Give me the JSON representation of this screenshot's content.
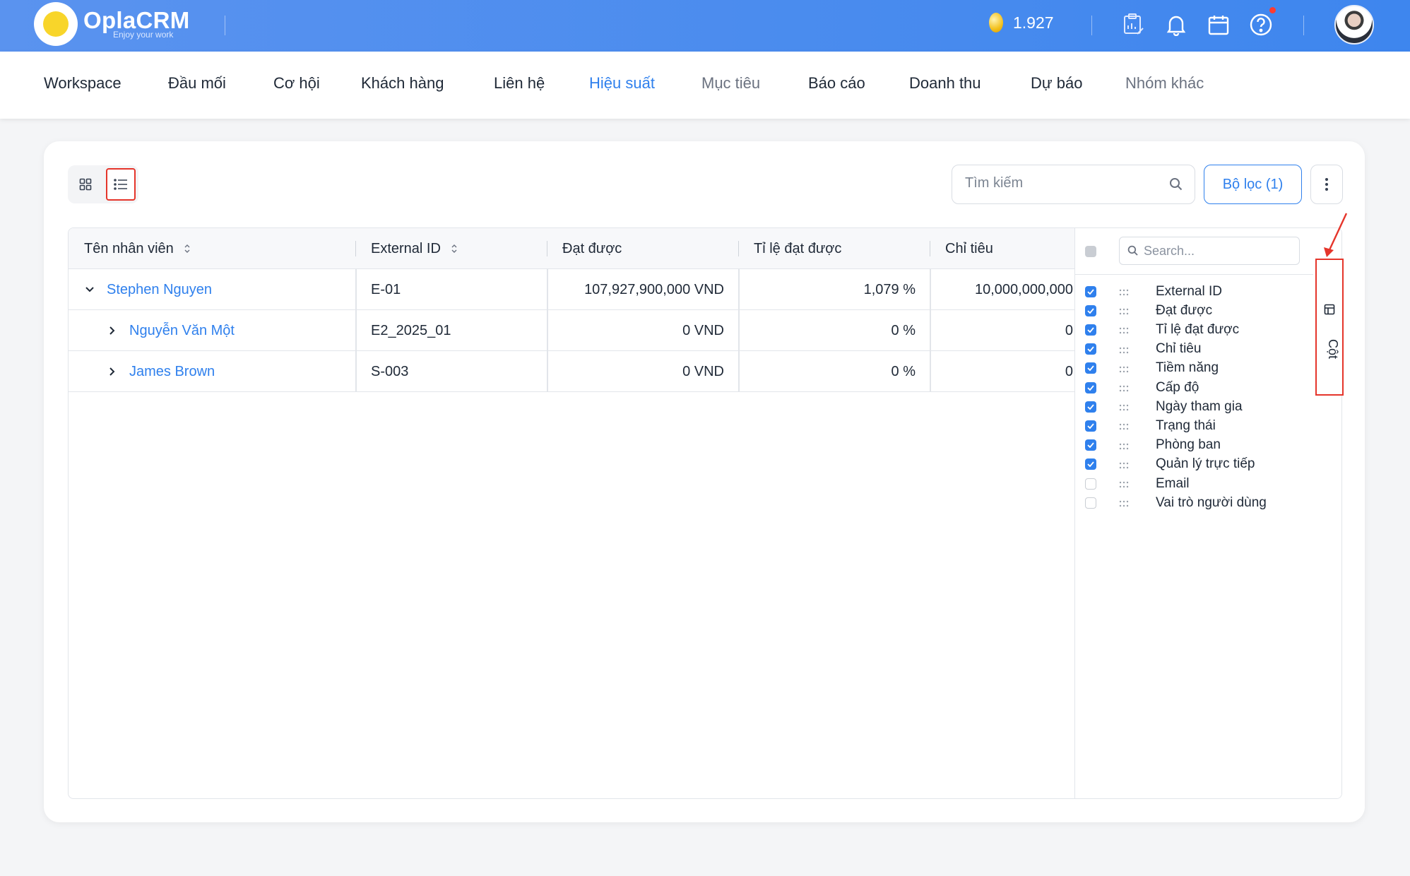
{
  "brand": {
    "name": "OplaCRM",
    "tagline": "Enjoy your work"
  },
  "topbar": {
    "coins": "1.927",
    "icons": [
      "clipboard-chart-icon",
      "bell-icon",
      "calendar-icon",
      "help-icon"
    ],
    "notification_dot_color": "#ff3b30"
  },
  "nav": {
    "items": [
      {
        "label": "Workspace"
      },
      {
        "label": "Đầu mối"
      },
      {
        "label": "Cơ hội"
      },
      {
        "label": "Khách hàng"
      },
      {
        "label": "Liên hệ"
      },
      {
        "label": "Hiệu suất"
      },
      {
        "label": "Mục tiêu"
      },
      {
        "label": "Báo cáo"
      },
      {
        "label": "Doanh thu"
      },
      {
        "label": "Dự báo"
      },
      {
        "label": "Nhóm khác"
      }
    ],
    "active": "Hiệu suất"
  },
  "toolbar": {
    "search_placeholder": "Tìm kiếm",
    "filter_label": "Bộ lọc (1)"
  },
  "table": {
    "headers": [
      "Tên nhân viên",
      "External ID",
      "Đạt được",
      "Tỉ lệ đạt được",
      "Chỉ tiêu"
    ],
    "rows": [
      {
        "name": "Stephen Nguyen",
        "external_id": "E-01",
        "achieved": "107,927,900,000 VND",
        "rate": "1,079 %",
        "target": "10,000,000,000",
        "expanded": true,
        "level": 0
      },
      {
        "name": "Nguyễn Văn Một",
        "external_id": "E2_2025_01",
        "achieved": "0 VND",
        "rate": "0 %",
        "target": "0",
        "expanded": false,
        "level": 1
      },
      {
        "name": "James Brown",
        "external_id": "S-003",
        "achieved": "0 VND",
        "rate": "0 %",
        "target": "0",
        "expanded": false,
        "level": 1
      }
    ]
  },
  "columns_panel": {
    "search_placeholder": "Search...",
    "tab_label": "Cột",
    "items": [
      {
        "label": "External ID",
        "checked": true
      },
      {
        "label": "Đạt được",
        "checked": true
      },
      {
        "label": "Tỉ lệ đạt được",
        "checked": true
      },
      {
        "label": "Chỉ tiêu",
        "checked": true
      },
      {
        "label": "Tiềm năng",
        "checked": true
      },
      {
        "label": "Cấp độ",
        "checked": true
      },
      {
        "label": "Ngày tham gia",
        "checked": true
      },
      {
        "label": "Trạng thái",
        "checked": true
      },
      {
        "label": "Phòng ban",
        "checked": true
      },
      {
        "label": "Quản lý trực tiếp",
        "checked": true
      },
      {
        "label": "Email",
        "checked": false
      },
      {
        "label": "Vai trò người dùng",
        "checked": false
      }
    ]
  },
  "colors": {
    "primary": "#2f80ed",
    "highlight": "#e5352b",
    "topbar": "#3e86ee"
  }
}
